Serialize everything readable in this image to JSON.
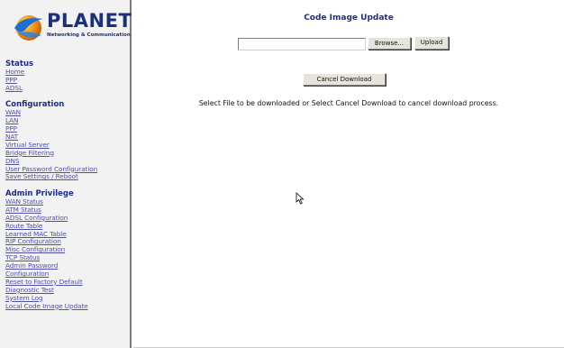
{
  "brand": {
    "name": "PLANET",
    "tagline": "Networking & Communication"
  },
  "nav": {
    "status": {
      "title": "Status",
      "items": [
        "Home",
        "PPP",
        "ADSL"
      ]
    },
    "configuration": {
      "title": "Configuration",
      "items": [
        "WAN",
        "LAN",
        "PPP",
        "NAT",
        "Virtual Server",
        "Bridge Filtering",
        "DNS",
        "User Password Configuration",
        "Save Settings / Reboot"
      ]
    },
    "admin": {
      "title": "Admin Privilege",
      "items": [
        "WAN Status",
        "ATM Status",
        "ADSL Configuration",
        "Route Table",
        "Learned MAC Table",
        "RIP Configuration",
        "Misc Configuration",
        "TCP Status",
        "Admin Password",
        "Configuration",
        "Reset to Factory Default",
        "Diagnostic Test",
        "System Log",
        "Local Code Image Update"
      ]
    }
  },
  "main": {
    "title": "Code Image Update",
    "file_value": "",
    "browse_label": "Browse...",
    "upload_label": "Upload",
    "cancel_label": "Cancel Download",
    "instructions": "Select File to be downloaded or Select Cancel Download to cancel download process."
  },
  "colors": {
    "section_title": "#1a2c8e",
    "link": "#5050a8",
    "brand": "#1c2f7a"
  }
}
